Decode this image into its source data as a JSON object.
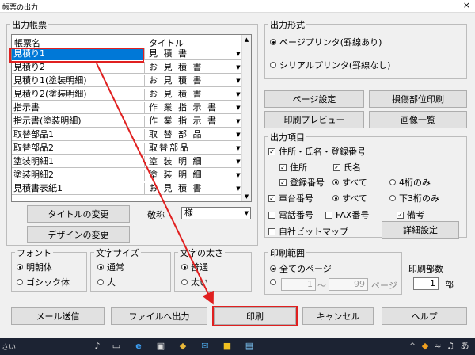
{
  "window": {
    "title": "帳票の出力",
    "close": "×"
  },
  "report_group": {
    "title": "出力帳票",
    "headers": [
      "帳票名",
      "タイトル"
    ],
    "rows": [
      {
        "name": "見積り1",
        "title": "見 積 書",
        "selected": true
      },
      {
        "name": "見積り2",
        "title": "お 見 積 書"
      },
      {
        "name": "見積り1(塗装明細)",
        "title": "お 見 積 書"
      },
      {
        "name": "見積り2(塗装明細)",
        "title": "お 見 積 書"
      },
      {
        "name": "指示書",
        "title": "作 業 指 示 書"
      },
      {
        "name": "指示書(塗装明細)",
        "title": "作 業 指 示 書"
      },
      {
        "name": "取替部品1",
        "title": "取 替 部 品"
      },
      {
        "name": "取替部品2",
        "title": "取替部品"
      },
      {
        "name": "塗装明細1",
        "title": "塗 装 明 細"
      },
      {
        "name": "塗装明細2",
        "title": "塗 装 明 細"
      },
      {
        "name": "見積書表紙1",
        "title": "お 見 積 書"
      }
    ],
    "change_title_button": "タイトルの変更",
    "honorific_label": "敬称",
    "honorific_value": "様",
    "change_design_button": "デザインの変更"
  },
  "font_group": {
    "title": "フォント",
    "options": [
      "明朝体",
      "ゴシック体"
    ],
    "selected": 0
  },
  "size_group": {
    "title": "文字サイズ",
    "options": [
      "通常",
      "大"
    ],
    "selected": 0
  },
  "weight_group": {
    "title": "文字の太さ",
    "options": [
      "普通",
      "太い"
    ],
    "selected": 0
  },
  "format_group": {
    "title": "出力形式",
    "options": [
      "ページプリンタ(罫線あり)",
      "シリアルプリンタ(罫線なし)"
    ],
    "selected": 0
  },
  "buttons_right": {
    "page_setup": "ページ設定",
    "damage_print": "損傷部位印刷",
    "print_preview": "印刷プレビュー",
    "image_list": "画像一覧",
    "detail_settings": "詳細設定"
  },
  "items_group": {
    "title": "出力項目",
    "address_reg": "住所・氏名・登録番号",
    "address": "住所",
    "name": "氏名",
    "reg_number": "登録番号",
    "all_1": "すべて",
    "last4": "4桁のみ",
    "chassis": "車台番号",
    "all_2": "すべて",
    "last3": "下3桁のみ",
    "phone": "電話番号",
    "fax": "FAX番号",
    "remarks": "備考",
    "bitmap": "自社ビットマップ"
  },
  "range_group": {
    "title": "印刷範囲",
    "all_pages": "全てのページ",
    "from": "1",
    "tilde": "～",
    "to": "99",
    "page_unit": "ページ"
  },
  "copies": {
    "label": "印刷部数",
    "value": "1",
    "unit": "部"
  },
  "bottom_buttons": {
    "mail": "メール送信",
    "file": "ファイルへ出力",
    "print": "印刷",
    "cancel": "キャンセル",
    "help": "ヘルプ"
  },
  "taskbar": {
    "search_text": "さい",
    "ime": "あ"
  },
  "colors": {
    "selection": "#0078d7",
    "highlight": "#e02020",
    "taskbar": "#1c2333"
  }
}
